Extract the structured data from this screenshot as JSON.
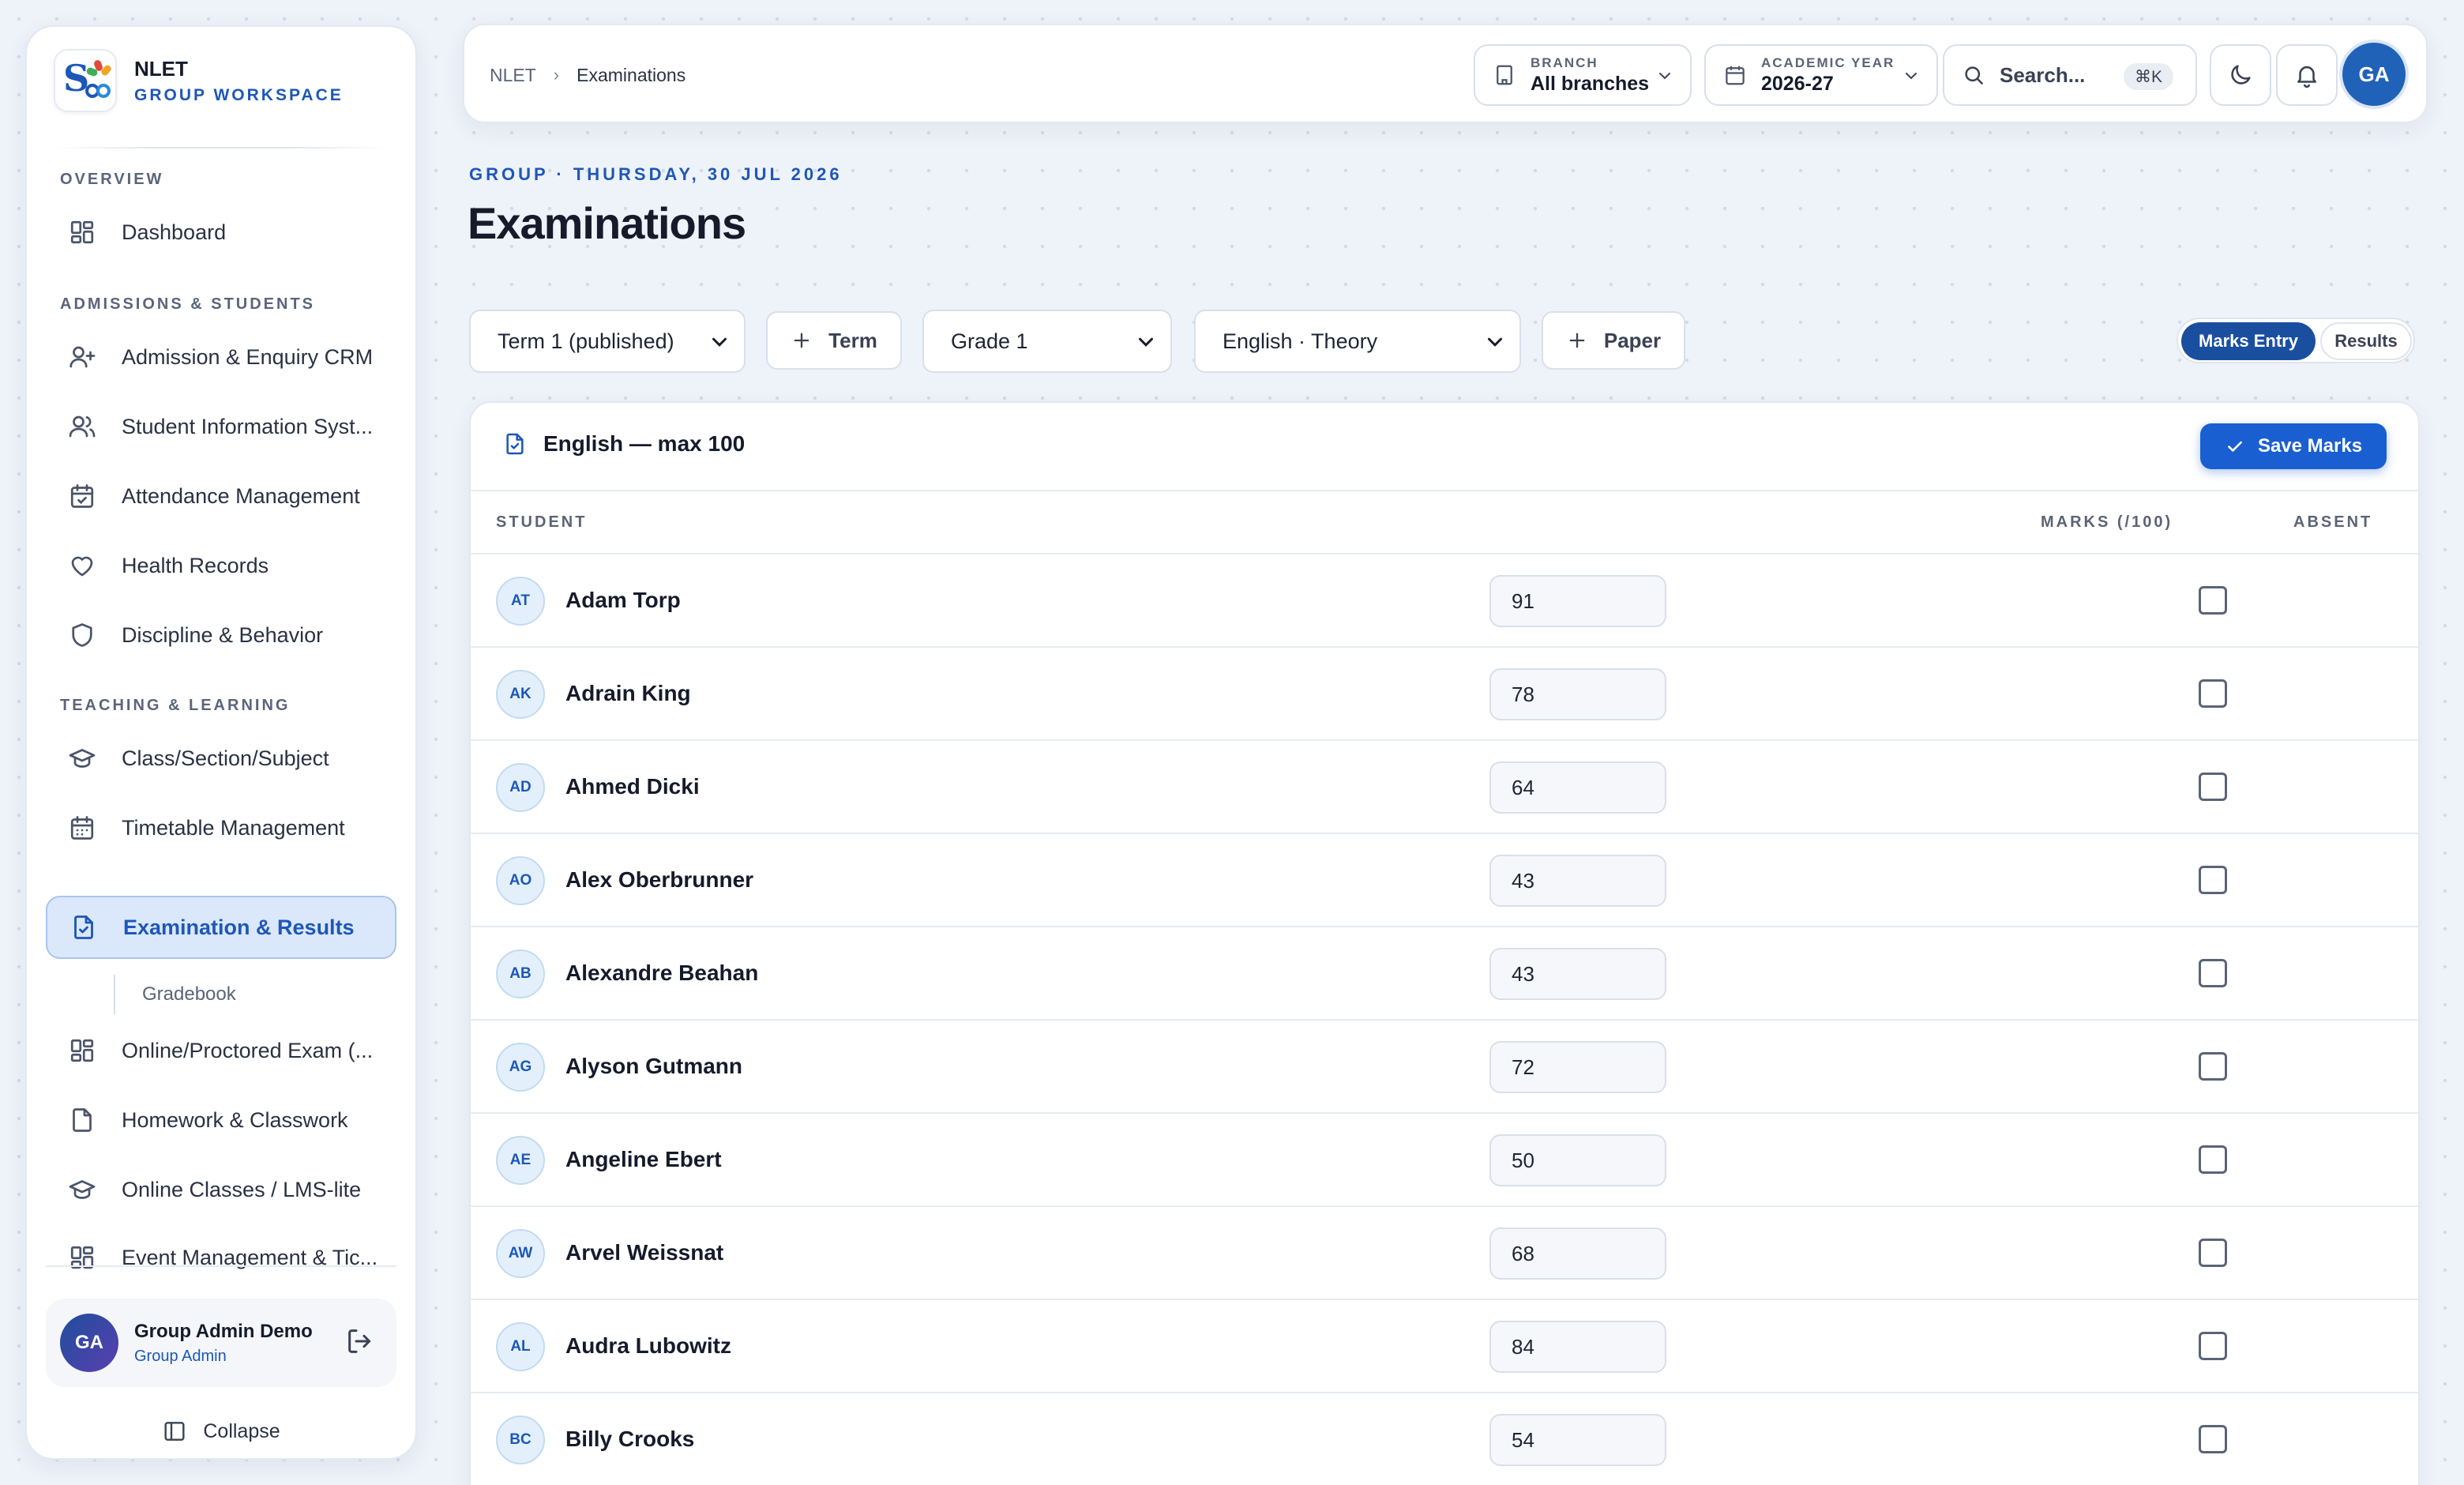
{
  "sidebar": {
    "brand": {
      "name": "NLET",
      "subtitle": "GROUP WORKSPACE"
    },
    "sections": [
      {
        "title": "OVERVIEW"
      },
      {
        "title": "ADMISSIONS & STUDENTS"
      },
      {
        "title": "TEACHING & LEARNING"
      }
    ],
    "items": [
      {
        "label": "Dashboard",
        "icon": "grid-icon"
      },
      {
        "label": "Admission & Enquiry CRM",
        "icon": "user-plus-icon"
      },
      {
        "label": "Student Information Syst...",
        "icon": "users-icon"
      },
      {
        "label": "Attendance Management",
        "icon": "calendar-check-icon"
      },
      {
        "label": "Health Records",
        "icon": "heart-icon"
      },
      {
        "label": "Discipline & Behavior",
        "icon": "shield-icon"
      },
      {
        "label": "Class/Section/Subject",
        "icon": "graduation-cap-icon"
      },
      {
        "label": "Timetable Management",
        "icon": "calendar-icon"
      },
      {
        "label": "Examination & Results",
        "icon": "file-check-icon",
        "active": true
      },
      {
        "label": "Online/Proctored Exam (...",
        "icon": "grid-icon"
      },
      {
        "label": "Homework & Classwork",
        "icon": "file-icon"
      },
      {
        "label": "Online Classes / LMS-lite",
        "icon": "graduation-cap-icon"
      },
      {
        "label": "Event Management & Tic...",
        "icon": "grid-icon"
      }
    ],
    "subitem": "Gradebook",
    "user": {
      "initials": "GA",
      "name": "Group Admin Demo",
      "role": "Group Admin"
    },
    "collapse_label": "Collapse"
  },
  "topbar": {
    "breadcrumb": [
      "NLET",
      "Examinations"
    ],
    "branch": {
      "label": "BRANCH",
      "value": "All branches"
    },
    "academic_year": {
      "label": "ACADEMIC YEAR",
      "value": "2026-27"
    },
    "search": {
      "placeholder": "Search...",
      "shortcut": "⌘K"
    },
    "avatar_initials": "GA"
  },
  "page": {
    "eyebrow": "GROUP · THURSDAY, 30 JUL 2026",
    "title": "Examinations"
  },
  "filters": {
    "term": "Term 1 (published)",
    "add_term_label": "Term",
    "grade": "Grade 1",
    "paper": "English · Theory",
    "add_paper_label": "Paper",
    "view_toggle": {
      "active": "Marks Entry",
      "inactive": "Results"
    }
  },
  "marks_card": {
    "title": "English — max 100",
    "save_label": "Save Marks",
    "columns": {
      "student": "STUDENT",
      "marks": "MARKS (/100)",
      "absent": "ABSENT"
    },
    "rows": [
      {
        "initials": "AT",
        "name": "Adam Torp",
        "marks": "91",
        "absent": false
      },
      {
        "initials": "AK",
        "name": "Adrain King",
        "marks": "78",
        "absent": false
      },
      {
        "initials": "AD",
        "name": "Ahmed Dicki",
        "marks": "64",
        "absent": false
      },
      {
        "initials": "AO",
        "name": "Alex Oberbrunner",
        "marks": "43",
        "absent": false
      },
      {
        "initials": "AB",
        "name": "Alexandre Beahan",
        "marks": "43",
        "absent": false
      },
      {
        "initials": "AG",
        "name": "Alyson Gutmann",
        "marks": "72",
        "absent": false
      },
      {
        "initials": "AE",
        "name": "Angeline Ebert",
        "marks": "50",
        "absent": false
      },
      {
        "initials": "AW",
        "name": "Arvel Weissnat",
        "marks": "68",
        "absent": false
      },
      {
        "initials": "AL",
        "name": "Audra Lubowitz",
        "marks": "84",
        "absent": false
      },
      {
        "initials": "BC",
        "name": "Billy Crooks",
        "marks": "54",
        "absent": false
      }
    ]
  },
  "colors": {
    "accent": "#1d57b8",
    "primary_button": "#1a5fd1",
    "active_nav_bg": "#dbe8fb"
  }
}
